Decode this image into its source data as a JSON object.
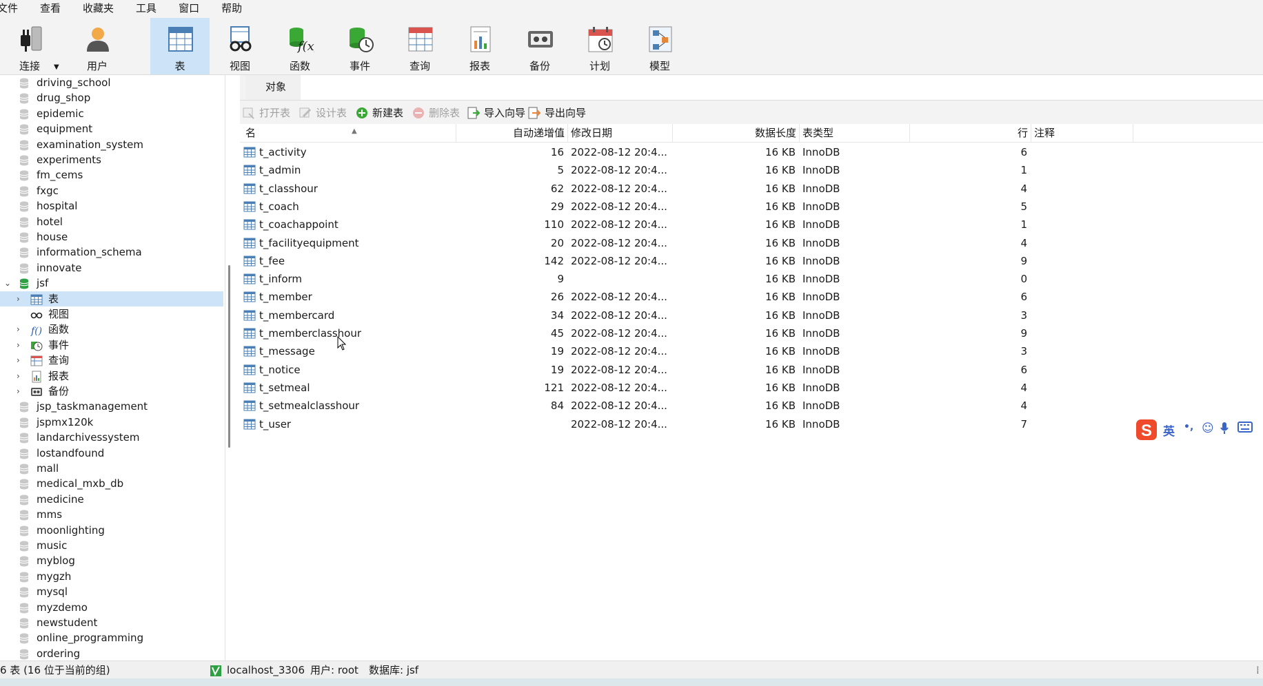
{
  "menu": [
    "文件",
    "查看",
    "收藏夹",
    "工具",
    "窗口",
    "帮助"
  ],
  "toolbar": {
    "items": [
      {
        "label": "连接",
        "icon": "connection-plug-icon"
      },
      {
        "label": "用户",
        "icon": "user-icon"
      },
      {
        "label": "表",
        "icon": "table-icon"
      },
      {
        "label": "视图",
        "icon": "view-glasses-icon"
      },
      {
        "label": "函数",
        "icon": "function-fx-icon"
      },
      {
        "label": "事件",
        "icon": "event-clock-icon"
      },
      {
        "label": "查询",
        "icon": "query-icon"
      },
      {
        "label": "报表",
        "icon": "report-icon"
      },
      {
        "label": "备份",
        "icon": "backup-icon"
      },
      {
        "label": "计划",
        "icon": "schedule-calendar-icon"
      },
      {
        "label": "模型",
        "icon": "model-icon"
      }
    ],
    "active_label": "表"
  },
  "sidebar": {
    "databases_before": [
      "driving_school",
      "drug_shop",
      "epidemic",
      "equipment",
      "examination_system",
      "experiments",
      "fm_cems",
      "fxgc",
      "hospital",
      "hotel",
      "house",
      "information_schema",
      "innovate"
    ],
    "open_db": "jsf",
    "open_db_children": [
      {
        "label": "表",
        "icon": "table-icon",
        "selected": true,
        "expandable": true
      },
      {
        "label": "视图",
        "icon": "view-glasses-icon",
        "selected": false,
        "expandable": false
      },
      {
        "label": "函数",
        "icon": "function-fx-icon",
        "selected": false,
        "expandable": true
      },
      {
        "label": "事件",
        "icon": "event-clock-icon",
        "selected": false,
        "expandable": true
      },
      {
        "label": "查询",
        "icon": "query-icon",
        "selected": false,
        "expandable": true
      },
      {
        "label": "报表",
        "icon": "report-icon",
        "selected": false,
        "expandable": true
      },
      {
        "label": "备份",
        "icon": "backup-icon",
        "selected": false,
        "expandable": true
      }
    ],
    "databases_after": [
      "jsp_taskmanagement",
      "jspmx120k",
      "landarchivessystem",
      "lostandfound",
      "mall",
      "medical_mxb_db",
      "medicine",
      "mms",
      "moonlighting",
      "music",
      "myblog",
      "mygzh",
      "mysql",
      "myzdemo",
      "newstudent",
      "online_programming",
      "ordering"
    ]
  },
  "tabs": {
    "objects_label": "对象"
  },
  "object_toolbar": [
    {
      "label": "打开表",
      "icon": "open-table-icon",
      "enabled": false
    },
    {
      "label": "设计表",
      "icon": "design-table-icon",
      "enabled": false
    },
    {
      "label": "新建表",
      "icon": "new-table-icon",
      "enabled": true
    },
    {
      "label": "删除表",
      "icon": "delete-table-icon",
      "enabled": false
    },
    {
      "label": "导入向导",
      "icon": "import-wizard-icon",
      "enabled": true
    },
    {
      "label": "导出向导",
      "icon": "export-wizard-icon",
      "enabled": true
    }
  ],
  "table": {
    "columns": [
      "名",
      "自动递增值",
      "修改日期",
      "数据长度",
      "表类型",
      "行",
      "注释"
    ],
    "rows": [
      {
        "name": "t_activity",
        "auto_inc": "16",
        "modified": "2022-08-12 20:4...",
        "size": "16 KB",
        "engine": "InnoDB",
        "rows": "6",
        "comment": ""
      },
      {
        "name": "t_admin",
        "auto_inc": "5",
        "modified": "2022-08-12 20:4...",
        "size": "16 KB",
        "engine": "InnoDB",
        "rows": "1",
        "comment": ""
      },
      {
        "name": "t_classhour",
        "auto_inc": "62",
        "modified": "2022-08-12 20:4...",
        "size": "16 KB",
        "engine": "InnoDB",
        "rows": "4",
        "comment": ""
      },
      {
        "name": "t_coach",
        "auto_inc": "29",
        "modified": "2022-08-12 20:4...",
        "size": "16 KB",
        "engine": "InnoDB",
        "rows": "5",
        "comment": ""
      },
      {
        "name": "t_coachappoint",
        "auto_inc": "110",
        "modified": "2022-08-12 20:4...",
        "size": "16 KB",
        "engine": "InnoDB",
        "rows": "1",
        "comment": ""
      },
      {
        "name": "t_facilityequipment",
        "auto_inc": "20",
        "modified": "2022-08-12 20:4...",
        "size": "16 KB",
        "engine": "InnoDB",
        "rows": "4",
        "comment": ""
      },
      {
        "name": "t_fee",
        "auto_inc": "142",
        "modified": "2022-08-12 20:4...",
        "size": "16 KB",
        "engine": "InnoDB",
        "rows": "9",
        "comment": ""
      },
      {
        "name": "t_inform",
        "auto_inc": "9",
        "modified": "",
        "size": "16 KB",
        "engine": "InnoDB",
        "rows": "0",
        "comment": ""
      },
      {
        "name": "t_member",
        "auto_inc": "26",
        "modified": "2022-08-12 20:4...",
        "size": "16 KB",
        "engine": "InnoDB",
        "rows": "6",
        "comment": ""
      },
      {
        "name": "t_membercard",
        "auto_inc": "34",
        "modified": "2022-08-12 20:4...",
        "size": "16 KB",
        "engine": "InnoDB",
        "rows": "3",
        "comment": ""
      },
      {
        "name": "t_memberclasshour",
        "auto_inc": "45",
        "modified": "2022-08-12 20:4...",
        "size": "16 KB",
        "engine": "InnoDB",
        "rows": "9",
        "comment": ""
      },
      {
        "name": "t_message",
        "auto_inc": "19",
        "modified": "2022-08-12 20:4...",
        "size": "16 KB",
        "engine": "InnoDB",
        "rows": "3",
        "comment": ""
      },
      {
        "name": "t_notice",
        "auto_inc": "19",
        "modified": "2022-08-12 20:4...",
        "size": "16 KB",
        "engine": "InnoDB",
        "rows": "6",
        "comment": ""
      },
      {
        "name": "t_setmeal",
        "auto_inc": "121",
        "modified": "2022-08-12 20:4...",
        "size": "16 KB",
        "engine": "InnoDB",
        "rows": "4",
        "comment": ""
      },
      {
        "name": "t_setmealclasshour",
        "auto_inc": "84",
        "modified": "2022-08-12 20:4...",
        "size": "16 KB",
        "engine": "InnoDB",
        "rows": "4",
        "comment": ""
      },
      {
        "name": "t_user",
        "auto_inc": "",
        "modified": "2022-08-12 20:4...",
        "size": "16 KB",
        "engine": "InnoDB",
        "rows": "7",
        "comment": ""
      }
    ]
  },
  "status": {
    "count_text": "6 表 (16 位于当前的组)",
    "connection": "localhost_3306",
    "user": "用户: root",
    "database": "数据库: jsf"
  },
  "ime": {
    "mode": "英",
    "punct": "•,",
    "emoji": "☺",
    "mic": "🎤",
    "keyboard": "⌨"
  },
  "colors": {
    "selection": "#cde3f8",
    "db_icon": "#c8c8c8",
    "open_db_icon": "#2ea043",
    "accent_green": "#3aa835"
  }
}
